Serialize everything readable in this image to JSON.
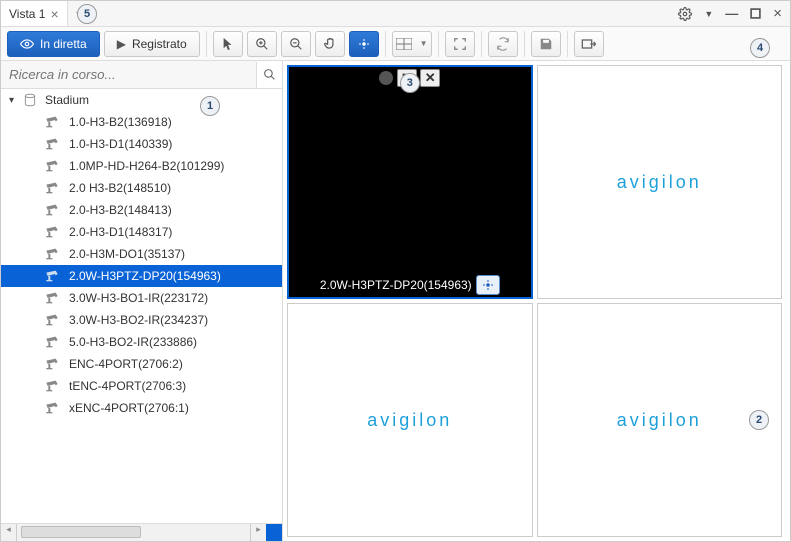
{
  "tab": {
    "title": "Vista 1"
  },
  "toolbar": {
    "live_label": "In diretta",
    "recorded_label": "Registrato"
  },
  "search": {
    "placeholder": "Ricerca in corso..."
  },
  "tree": {
    "site": "Stadium",
    "cameras": [
      "1.0-H3-B2(136918)",
      "1.0-H3-D1(140339)",
      "1.0MP-HD-H264-B2(101299)",
      "2.0 H3-B2(148510)",
      "2.0-H3-B2(148413)",
      "2.0-H3-D1(148317)",
      "2.0-H3M-DO1(35137)",
      "2.0W-H3PTZ-DP20(154963)",
      "3.0W-H3-BO1-IR(223172)",
      "3.0W-H3-BO2-IR(234237)",
      "5.0-H3-BO2-IR(233886)",
      "ENC-4PORT(2706:2)",
      "tENC-4PORT(2706:3)",
      "xENC-4PORT(2706:1)"
    ],
    "selected_index": 7
  },
  "video": {
    "label": "2.0W-H3PTZ-DP20(154963)"
  },
  "logo_text": "avigilon",
  "callouts": {
    "c1": "1",
    "c2": "2",
    "c3": "3",
    "c4": "4",
    "c5": "5"
  }
}
